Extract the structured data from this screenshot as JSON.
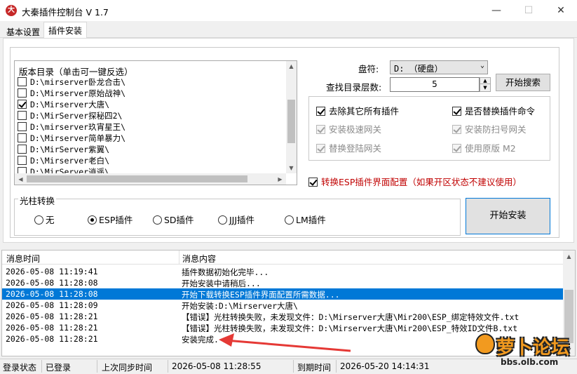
{
  "window": {
    "title": "大秦插件控制台 V 1.7",
    "icon_name": "app-logo-icon"
  },
  "tabs": [
    {
      "label": "基本设置",
      "active": false
    },
    {
      "label": "插件安装",
      "active": true
    }
  ],
  "directory_list": {
    "header": "版本目录（单击可一键反选）",
    "items": [
      {
        "label": "D:\\mirserver卧龙合击\\",
        "checked": false
      },
      {
        "label": "D:\\Mirserver原始战神\\",
        "checked": false
      },
      {
        "label": "D:\\Mirserver大唐\\",
        "checked": true
      },
      {
        "label": "D:\\MirServer探秘四2\\",
        "checked": false
      },
      {
        "label": "D:\\mirserver玖宵星王\\",
        "checked": false
      },
      {
        "label": "D:\\Mirserver简单暴力\\",
        "checked": false
      },
      {
        "label": "D:\\MirServer紫翼\\",
        "checked": false
      },
      {
        "label": "D:\\Mirserver老白\\",
        "checked": false
      },
      {
        "label": "D:\\MirServer逍遥\\",
        "checked": false
      }
    ]
  },
  "drive": {
    "label": "盘符:",
    "value": "D: （硬盘）"
  },
  "depth": {
    "label": "查找目录层数:",
    "value": "5"
  },
  "search_button": "开始搜索",
  "options": [
    {
      "label": "去除其它所有插件",
      "checked": true,
      "enabled": true
    },
    {
      "label": "是否替换插件命令",
      "checked": true,
      "enabled": true
    },
    {
      "label": "安装极速网关",
      "checked": true,
      "enabled": false
    },
    {
      "label": "安装防扫号网关",
      "checked": true,
      "enabled": false
    },
    {
      "label": "替换登陆网关",
      "checked": true,
      "enabled": false
    },
    {
      "label": "使用原版 M2",
      "checked": true,
      "enabled": false
    }
  ],
  "esp_convert": {
    "label": "转换ESP插件界面配置（如果开区状态不建议使用）",
    "checked": true,
    "color": "#c00000"
  },
  "beam": {
    "title": "光柱转换",
    "options": [
      {
        "label": "无",
        "selected": false
      },
      {
        "label": "ESP插件",
        "selected": true
      },
      {
        "label": "SD插件",
        "selected": false
      },
      {
        "label": "JJJ插件",
        "selected": false
      },
      {
        "label": "LM插件",
        "selected": false
      }
    ]
  },
  "install_button": "开始安装",
  "log": {
    "columns": [
      "消息时间",
      "消息内容"
    ],
    "rows": [
      {
        "time": "2026-05-08 11:19:41",
        "msg": "插件数据初始化完毕...",
        "selected": false
      },
      {
        "time": "2026-05-08 11:28:08",
        "msg": "开始安装中请稍后...",
        "selected": false
      },
      {
        "time": "2026-05-08 11:28:08",
        "msg": "开始下载转换ESP插件界面配置所需数据...",
        "selected": true
      },
      {
        "time": "2026-05-08 11:28:09",
        "msg": "开始安装:D:\\Mirserver大唐\\",
        "selected": false
      },
      {
        "time": "2026-05-08 11:28:21",
        "msg": "【错误】光柱转换失败，未发现文件：D:\\Mirserver大唐\\Mir200\\ESP_绑定特效文件.txt",
        "selected": false
      },
      {
        "time": "2026-05-08 11:28:21",
        "msg": "【错误】光柱转换失败，未发现文件：D:\\Mirserver大唐\\Mir200\\ESP_特效ID文件B.txt",
        "selected": false
      },
      {
        "time": "2026-05-08 11:28:21",
        "msg": "安装完成.",
        "selected": false
      }
    ]
  },
  "status": {
    "login_label": "登录状态",
    "login_value": "已登录",
    "sync_label": "上次同步时间",
    "sync_value": "2026-05-08 11:28:55",
    "expire_label": "到期时间",
    "expire_value": "2026-05-20 14:14:31"
  },
  "watermark": {
    "text": "萝卜论坛",
    "url": "bbs.olb.com"
  },
  "colors": {
    "selection": "#0078d7",
    "annotation_arrow": "#e53935",
    "watermark_orange": "#f29a1f"
  }
}
